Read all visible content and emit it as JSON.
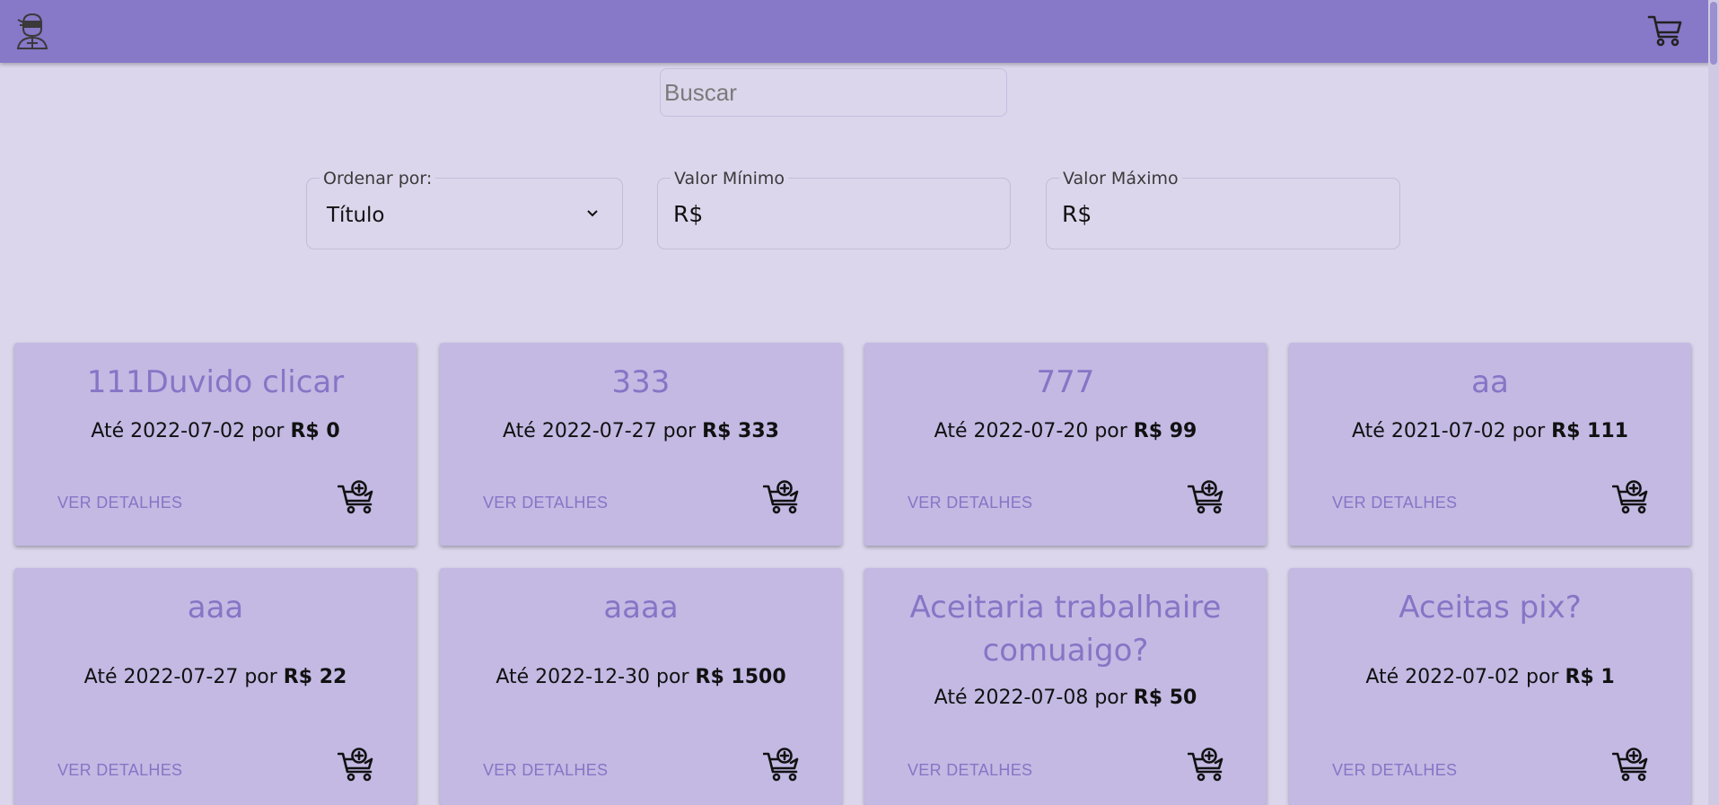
{
  "header": {
    "logo_icon": "ninja-avatar-icon",
    "cart_icon": "shopping-cart-icon"
  },
  "search": {
    "placeholder": "Buscar",
    "value": ""
  },
  "filters": {
    "sort": {
      "label": "Ordenar por:",
      "selected": "Título"
    },
    "min": {
      "label": "Valor Mínimo",
      "prefix": "R$"
    },
    "max": {
      "label": "Valor Máximo",
      "prefix": "R$"
    }
  },
  "cards": [
    {
      "title": "111Duvido clicar",
      "prefix": "Até 2022-07-02 por ",
      "price": "R$ 0",
      "details": "VER DETALHES"
    },
    {
      "title": "333",
      "prefix": "Até 2022-07-27 por ",
      "price": "R$ 333",
      "details": "VER DETALHES"
    },
    {
      "title": "777",
      "prefix": "Até 2022-07-20 por ",
      "price": "R$ 99",
      "details": "VER DETALHES"
    },
    {
      "title": "aa",
      "prefix": "Até 2021-07-02 por ",
      "price": "R$ 111",
      "details": "VER DETALHES"
    },
    {
      "title": "aaa",
      "prefix": "Até 2022-07-27 por ",
      "price": "R$ 22",
      "details": "VER DETALHES"
    },
    {
      "title": "aaaa",
      "prefix": "Até 2022-12-30 por ",
      "price": "R$ 1500",
      "details": "VER DETALHES"
    },
    {
      "title_line1": "Aceitaria trabalhaire",
      "title_line2": "comuaigo?",
      "prefix": "Até 2022-07-08 por ",
      "price": "R$ 50",
      "details": "VER DETALHES"
    },
    {
      "title": "Aceitas pix?",
      "prefix": "Até 2022-07-02 por ",
      "price": "R$ 1",
      "details": "VER DETALHES"
    }
  ],
  "colors": {
    "header": "#8878c8",
    "background": "#dcd6ec",
    "card": "#c3b9e3",
    "accent": "#8675c6"
  }
}
